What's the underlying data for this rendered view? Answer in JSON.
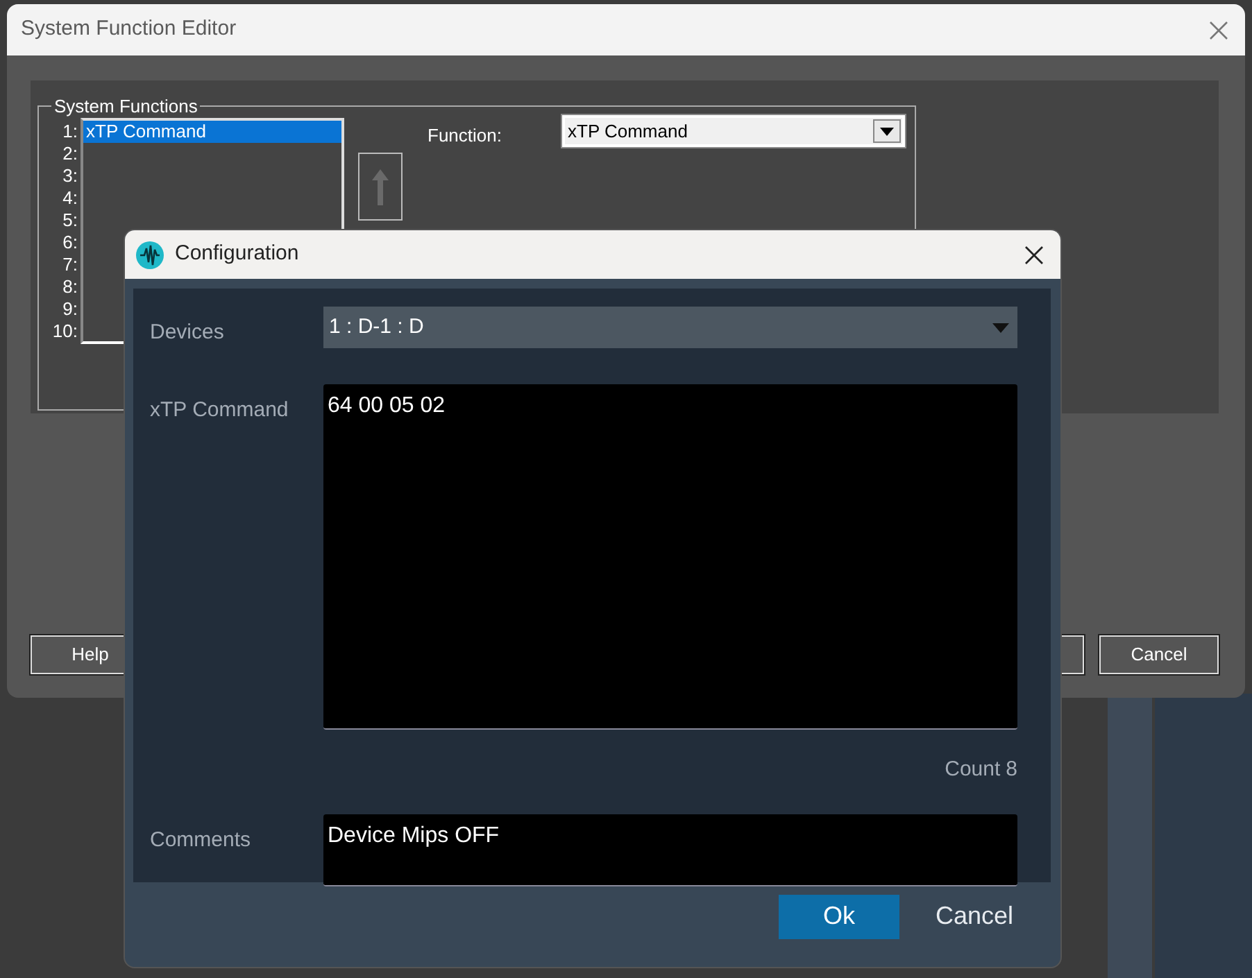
{
  "editor": {
    "title": "System Function Editor",
    "group_title": "System Functions",
    "slots": [
      {
        "number": "1:",
        "function": "xTP Command",
        "selected": true
      },
      {
        "number": "2:",
        "selected": false
      },
      {
        "number": "3:",
        "selected": false
      },
      {
        "number": "4:",
        "selected": false
      },
      {
        "number": "5:",
        "selected": false
      },
      {
        "number": "6:",
        "selected": false
      },
      {
        "number": "7:",
        "selected": false
      },
      {
        "number": "8:",
        "selected": false
      },
      {
        "number": "9:",
        "selected": false
      },
      {
        "number": "10:",
        "selected": false
      }
    ],
    "function_label": "Function:",
    "function_value": "xTP Command",
    "buttons": [
      "Help",
      "Cancel"
    ]
  },
  "configuration": {
    "title": "Configuration",
    "fields": [
      {
        "kind": "select",
        "label": "Devices",
        "value": "1 : D-1 : D"
      },
      {
        "kind": "textarea",
        "label": "xTP Command",
        "value": "64 00 05 02"
      },
      {
        "kind": "comment",
        "label": "Comments",
        "value": "Device Mips OFF"
      }
    ],
    "count_label": "Count",
    "count": "8",
    "buttons": [
      {
        "label": "Ok",
        "primary": true
      },
      {
        "label": "Cancel",
        "primary": false
      }
    ]
  }
}
